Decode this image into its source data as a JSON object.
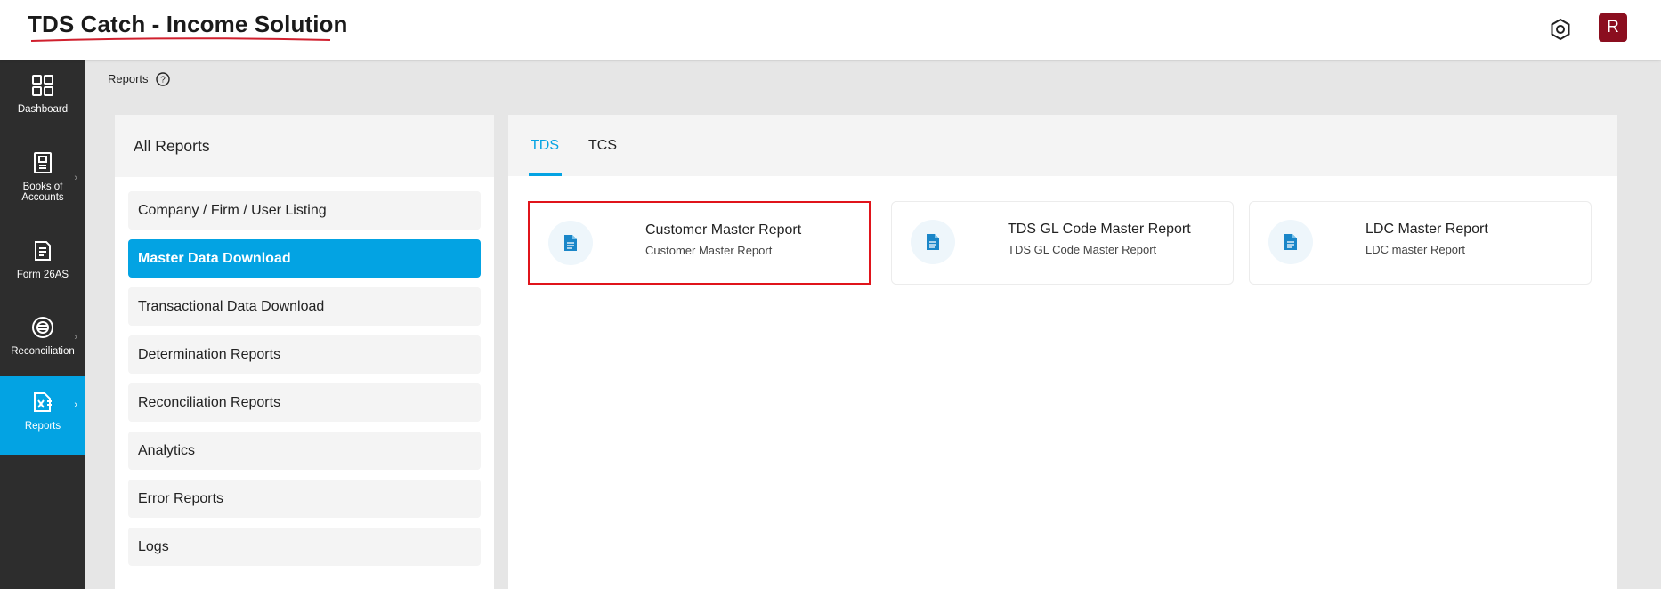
{
  "app": {
    "title": "TDS Catch - Income Solution",
    "avatar_initial": "R",
    "accent_color": "#03a3e3",
    "brand_color": "#8b0e1f"
  },
  "sidebar": {
    "items": [
      {
        "label": "Dashboard",
        "icon": "grid-icon",
        "has_chevron": false,
        "active": false
      },
      {
        "label": "Books of Accounts",
        "icon": "book-icon",
        "has_chevron": true,
        "active": false
      },
      {
        "label": "Form 26AS",
        "icon": "form-icon",
        "has_chevron": false,
        "active": false
      },
      {
        "label": "Reconciliation",
        "icon": "reconciliation-icon",
        "has_chevron": true,
        "active": false
      },
      {
        "label": "Reports",
        "icon": "excel-file-icon",
        "has_chevron": true,
        "active": true
      }
    ]
  },
  "breadcrumb": {
    "label": "Reports"
  },
  "reports_panel": {
    "title": "All Reports",
    "items": [
      {
        "label": "Company / Firm / User Listing",
        "active": false
      },
      {
        "label": "Master Data Download",
        "active": true
      },
      {
        "label": "Transactional Data Download",
        "active": false
      },
      {
        "label": "Determination Reports",
        "active": false
      },
      {
        "label": "Reconciliation Reports",
        "active": false
      },
      {
        "label": "Analytics",
        "active": false
      },
      {
        "label": "Error Reports",
        "active": false
      },
      {
        "label": "Logs",
        "active": false
      }
    ]
  },
  "tabs": [
    {
      "label": "TDS",
      "active": true
    },
    {
      "label": "TCS",
      "active": false
    }
  ],
  "cards": [
    {
      "title": "Customer Master Report",
      "subtitle": "Customer Master Report",
      "icon": "document-icon",
      "highlighted": true
    },
    {
      "title": "TDS GL Code Master Report",
      "subtitle": "TDS GL Code Master Report",
      "icon": "document-icon",
      "highlighted": false
    },
    {
      "title": "LDC Master Report",
      "subtitle": "LDC master Report",
      "icon": "document-icon",
      "highlighted": false
    }
  ]
}
